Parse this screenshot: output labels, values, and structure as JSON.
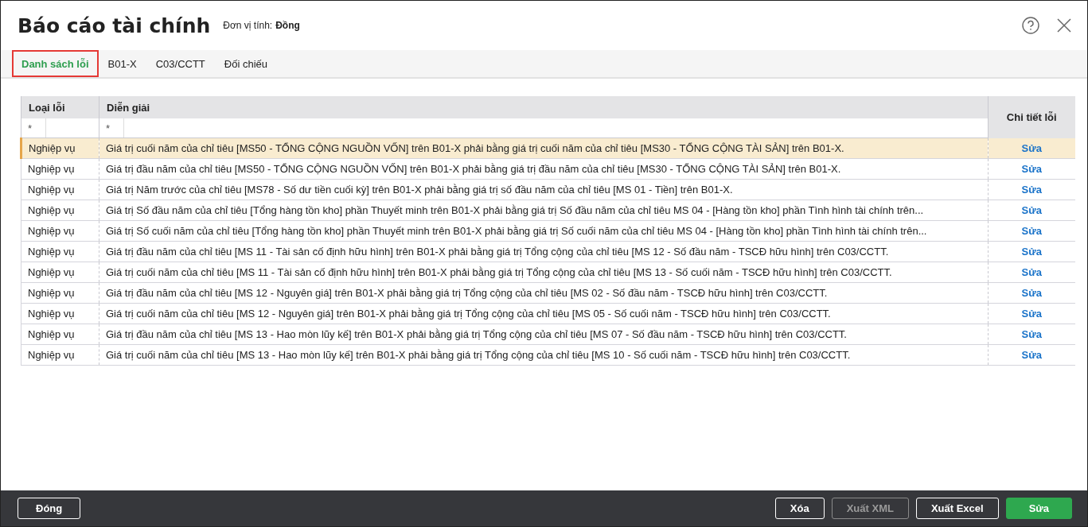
{
  "window": {
    "title": "Báo cáo tài chính",
    "unit_label": "Đơn vị tính:",
    "unit_value": "Đồng"
  },
  "tabs": [
    {
      "label": "Danh sách lỗi",
      "selected": true
    },
    {
      "label": "B01-X",
      "selected": false
    },
    {
      "label": "C03/CCTT",
      "selected": false
    },
    {
      "label": "Đối chiếu",
      "selected": false
    }
  ],
  "table": {
    "columns": [
      "Loại lỗi",
      "Diễn giải",
      "Chi tiết lỗi"
    ],
    "filters": [
      "*",
      "*"
    ],
    "rows": [
      {
        "type": "Nghiệp vụ",
        "description": "Giá trị cuối năm của chỉ tiêu [MS50 - TỔNG CỘNG NGUỒN VỐN] trên B01-X phải bằng giá trị cuối năm của chỉ tiêu [MS30 - TỔNG CỘNG TÀI SẢN] trên B01-X.",
        "action": "Sửa",
        "selected": true
      },
      {
        "type": "Nghiệp vụ",
        "description": "Giá trị đầu năm của chỉ tiêu [MS50 - TỔNG CỘNG NGUỒN VỐN] trên B01-X phải bằng giá trị đầu năm của chỉ tiêu [MS30 - TỔNG CỘNG TÀI SẢN] trên B01-X.",
        "action": "Sửa",
        "selected": false
      },
      {
        "type": "Nghiệp vụ",
        "description": "Giá trị Năm trước của chỉ tiêu [MS78 - Số dư tiền cuối kỳ] trên B01-X phải bằng giá trị số đầu năm của chỉ tiêu [MS 01 - Tiền] trên B01-X.",
        "action": "Sửa",
        "selected": false
      },
      {
        "type": "Nghiệp vụ",
        "description": "Giá trị Số đầu năm của chỉ tiêu [Tổng hàng tồn kho] phần Thuyết minh trên B01-X phải bằng giá trị Số đầu năm của chỉ tiêu MS 04 - [Hàng tồn kho] phần Tình hình tài chính trên...",
        "action": "Sửa",
        "selected": false
      },
      {
        "type": "Nghiệp vụ",
        "description": "Giá trị Số cuối năm của chỉ tiêu [Tổng hàng tồn kho] phần Thuyết minh trên B01-X phải bằng giá trị Số cuối năm của chỉ tiêu MS 04 - [Hàng tồn kho] phần Tình hình tài chính trên...",
        "action": "Sửa",
        "selected": false
      },
      {
        "type": "Nghiệp vụ",
        "description": "Giá trị đầu năm của chỉ tiêu [MS 11 - Tài sản cố định hữu hình] trên B01-X phải bằng giá trị Tổng cộng của chỉ tiêu [MS 12 - Số đầu năm - TSCĐ hữu hình] trên C03/CCTT.",
        "action": "Sửa",
        "selected": false
      },
      {
        "type": "Nghiệp vụ",
        "description": "Giá trị cuối năm của chỉ tiêu [MS 11 - Tài sản cố định hữu hình] trên B01-X phải bằng giá trị Tổng cộng của chỉ tiêu [MS 13 - Số cuối năm - TSCĐ hữu hình] trên C03/CCTT.",
        "action": "Sửa",
        "selected": false
      },
      {
        "type": "Nghiệp vụ",
        "description": "Giá trị đầu năm của chỉ tiêu [MS 12 - Nguyên giá] trên B01-X phải bằng giá trị Tổng cộng của chỉ tiêu [MS 02 - Số đầu năm - TSCĐ hữu hình] trên C03/CCTT.",
        "action": "Sửa",
        "selected": false
      },
      {
        "type": "Nghiệp vụ",
        "description": "Giá trị cuối năm của chỉ tiêu [MS 12 - Nguyên giá] trên B01-X phải bằng giá trị Tổng cộng của chỉ tiêu [MS 05 - Số cuối năm - TSCĐ hữu hình] trên C03/CCTT.",
        "action": "Sửa",
        "selected": false
      },
      {
        "type": "Nghiệp vụ",
        "description": "Giá trị đầu năm của chỉ tiêu [MS 13 - Hao mòn lũy kế] trên B01-X phải bằng giá trị Tổng cộng của chỉ tiêu [MS 07 - Số đầu năm - TSCĐ hữu hình] trên C03/CCTT.",
        "action": "Sửa",
        "selected": false
      },
      {
        "type": "Nghiệp vụ",
        "description": "Giá trị cuối năm của chỉ tiêu [MS 13 - Hao mòn lũy kế] trên B01-X phải bằng giá trị Tổng cộng của chỉ tiêu [MS 10 - Số cuối năm - TSCĐ hữu hình] trên C03/CCTT.",
        "action": "Sửa",
        "selected": false
      }
    ]
  },
  "footer": {
    "left_buttons": [
      {
        "label": "Đóng",
        "kind": "outline",
        "disabled": false
      }
    ],
    "right_buttons": [
      {
        "label": "Xóa",
        "kind": "outline",
        "disabled": false
      },
      {
        "label": "Xuất XML",
        "kind": "outline",
        "disabled": true
      },
      {
        "label": "Xuất Excel",
        "kind": "outline",
        "disabled": false
      },
      {
        "label": "Sửa",
        "kind": "primary",
        "disabled": false
      }
    ]
  }
}
